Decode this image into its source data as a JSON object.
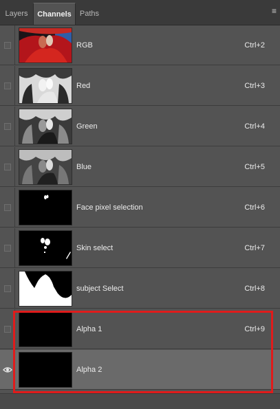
{
  "tabs": [
    {
      "label": "Layers",
      "active": false
    },
    {
      "label": "Channels",
      "active": true
    },
    {
      "label": "Paths",
      "active": false
    }
  ],
  "panel_menu_icon": "hamburger-menu-icon",
  "channels": [
    {
      "name": "RGB",
      "shortcut": "Ctrl+2",
      "visible": false,
      "selected": false,
      "thumbnail": "color"
    },
    {
      "name": "Red",
      "shortcut": "Ctrl+3",
      "visible": false,
      "selected": false,
      "thumbnail": "gray-light"
    },
    {
      "name": "Green",
      "shortcut": "Ctrl+4",
      "visible": false,
      "selected": false,
      "thumbnail": "gray-dark"
    },
    {
      "name": "Blue",
      "shortcut": "Ctrl+5",
      "visible": false,
      "selected": false,
      "thumbnail": "gray-dark"
    },
    {
      "name": "Face pixel selection",
      "shortcut": "Ctrl+6",
      "visible": false,
      "selected": false,
      "thumbnail": "mask-face"
    },
    {
      "name": "Skin select",
      "shortcut": "Ctrl+7",
      "visible": false,
      "selected": false,
      "thumbnail": "mask-skin"
    },
    {
      "name": "subject Select",
      "shortcut": "Ctrl+8",
      "visible": false,
      "selected": false,
      "thumbnail": "mask-subject"
    },
    {
      "name": "Alpha 1",
      "shortcut": "Ctrl+9",
      "visible": false,
      "selected": false,
      "thumbnail": "black"
    },
    {
      "name": "Alpha 2",
      "shortcut": "",
      "visible": true,
      "selected": true,
      "thumbnail": "black"
    }
  ],
  "colors": {
    "panel_bg": "#535353",
    "selected_row_bg": "#6a6a6a",
    "annotation_border": "#e01b1b"
  }
}
